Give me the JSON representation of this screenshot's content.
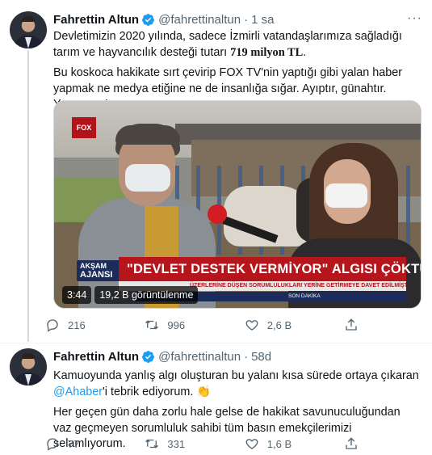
{
  "tweets": [
    {
      "author": {
        "name": "Fahrettin Altun",
        "handle": "@fahrettinaltun",
        "verified": true
      },
      "time": "1 sa",
      "more_icon": "more-horizontal-icon",
      "text_p1_a": "Devletimizin 2020 yılında, sadece İzmirli vatandaşlarımıza sağladığı tarım ve hayvancılık desteği tutarı ",
      "text_p1_bold": "719 milyon TL",
      "text_p1_c": ".",
      "text_p2": "Bu koskoca hakikate sırt çevirip FOX TV'nin yaptığı gibi yalan haber yapmak ne medya etiğine ne de insanlığa sığar. Ayıptır, günahtır. Yapmayın!",
      "video": {
        "duration": "3:44",
        "views": "19,2 B görüntülenme",
        "ticker_brand_1": "AKŞAM",
        "ticker_brand_2": "AJANSI",
        "headline": "\"DEVLET DESTEK VERMİYOR\" ALGISI ÇÖKTÜ",
        "ticker_sub": "ÜZERLERİNE DÜŞEN SORUMLULUKLARI YERİNE GETİRMEYE DAVET EDİLMİŞTİR",
        "ticker_bottom": "SON DAKİKA",
        "channel": "FOX"
      },
      "stats": {
        "replies": "216",
        "retweets": "996",
        "likes": "2,6 B"
      }
    },
    {
      "author": {
        "name": "Fahrettin Altun",
        "handle": "@fahrettinaltun",
        "verified": true
      },
      "time": "58d",
      "text_p1_a": "Kamuoyunda yanlış algı oluşturan bu yalanı kısa sürede ortaya çıkaran ",
      "text_p1_mention": "@Ahaber",
      "text_p1_c": "'i tebrik ediyorum. ",
      "text_p1_emoji": "👏",
      "text_p2": "Her geçen gün daha zorlu hale gelse de hakikat savunuculuğundan vaz geçmeyen sorumluluk sahibi tüm basın emekçilerimizi selamlıyorum.",
      "stats": {
        "replies": "77",
        "retweets": "331",
        "likes": "1,6 B"
      }
    }
  ],
  "colors": {
    "accent": "#1d9bf0",
    "muted": "#536471",
    "text": "#0f1419",
    "ticker_red": "#b5151b"
  },
  "icons": [
    "reply-icon",
    "retweet-icon",
    "like-icon",
    "share-icon",
    "verified-badge-icon"
  ]
}
